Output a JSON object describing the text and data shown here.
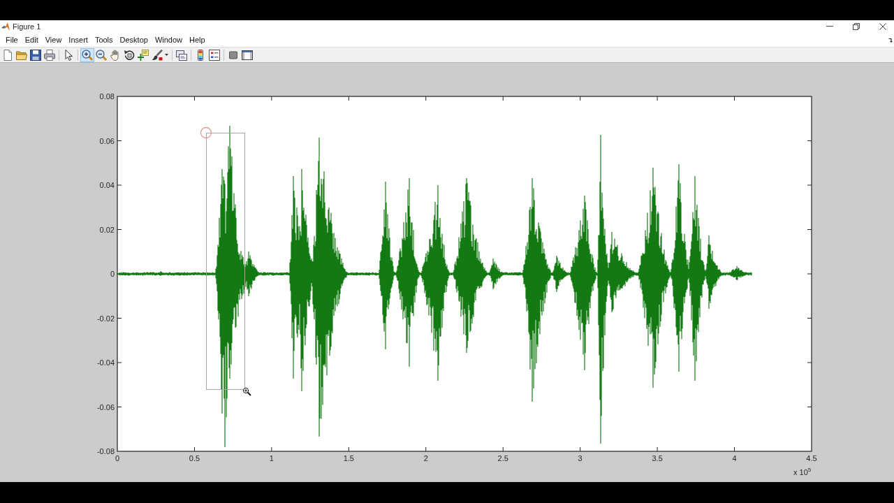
{
  "window": {
    "title": "Figure 1"
  },
  "menu_bar": [
    "File",
    "Edit",
    "View",
    "Insert",
    "Tools",
    "Desktop",
    "Window",
    "Help"
  ],
  "toolbar": [
    [
      {
        "kind": "new",
        "selected": false
      },
      {
        "kind": "open",
        "selected": false
      },
      {
        "kind": "save",
        "selected": false
      },
      {
        "kind": "print",
        "selected": false
      }
    ],
    [
      {
        "kind": "edit",
        "selected": false
      }
    ],
    [
      {
        "kind": "zoomin",
        "selected": true
      },
      {
        "kind": "zoomout",
        "selected": false
      },
      {
        "kind": "pan",
        "selected": false
      },
      {
        "kind": "rotate",
        "selected": false
      },
      {
        "kind": "datacursor",
        "selected": false
      },
      {
        "kind": "brush",
        "selected": false
      }
    ],
    [
      {
        "kind": "link",
        "selected": false
      }
    ],
    [
      {
        "kind": "colorbar",
        "selected": false
      },
      {
        "kind": "legend",
        "selected": false
      }
    ],
    [
      {
        "kind": "hidetools",
        "selected": false
      },
      {
        "kind": "showtools",
        "selected": false
      }
    ]
  ],
  "axes": {
    "y_tick_labels": [
      "0.08",
      "0.06",
      "0.04",
      "0.02",
      "0",
      "-0.02",
      "-0.04",
      "-0.06",
      "-0.08"
    ],
    "x_tick_labels": [
      "0",
      "0.5",
      "1",
      "1.5",
      "2",
      "2.5",
      "3",
      "3.5",
      "4",
      "4.5"
    ],
    "x_exponent_label": "x 10$^{5}$"
  }
}
